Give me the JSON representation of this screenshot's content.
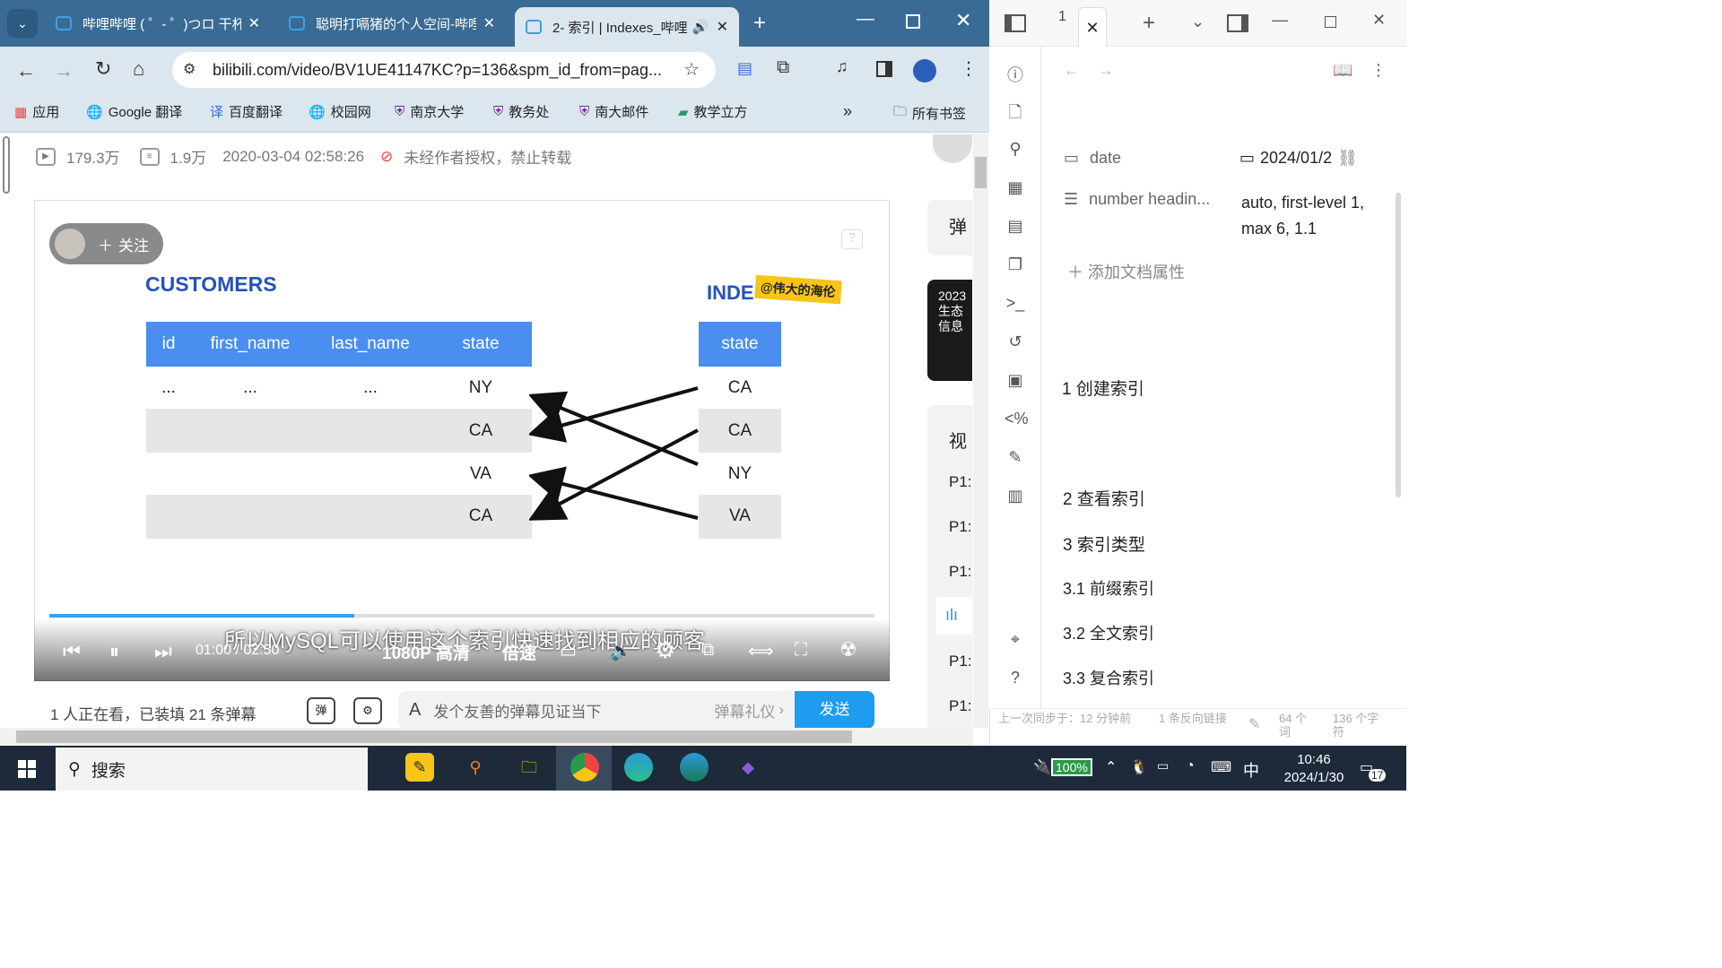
{
  "tabs": [
    {
      "title": "哔哩哔哩 ( ゜- ゜)つロ 干杯",
      "active": false
    },
    {
      "title": "聪明打嗝猪的个人空间-哔哩",
      "active": false
    },
    {
      "title": "2- 索引 | Indexes_哔哩",
      "active": true
    }
  ],
  "url": "bilibili.com/video/BV1UE41147KC?p=136&spm_id_from=pag...",
  "bookmarks": [
    "应用",
    "Google 翻译",
    "百度翻译",
    "校园网",
    "南京大学",
    "教务处",
    "南大邮件",
    "教学立方"
  ],
  "bookmarks_all": "所有书签",
  "video_meta": {
    "views": "179.3万",
    "danmaku": "1.9万",
    "date": "2020-03-04 02:58:26",
    "notice": "未经作者授权，禁止转载"
  },
  "follow": "关注",
  "customers_title": "CUSTOMERS",
  "index_title": "INDE",
  "watermark": "@伟大的海伦",
  "customers_headers": [
    "id",
    "first_name",
    "last_name",
    "state"
  ],
  "customers_rows": [
    [
      "...",
      "...",
      "...",
      "NY"
    ],
    [
      "",
      "",
      "",
      "CA"
    ],
    [
      "",
      "",
      "",
      "VA"
    ],
    [
      "",
      "",
      "",
      "CA"
    ]
  ],
  "index_header": "state",
  "index_rows": [
    "CA",
    "CA",
    "NY",
    "VA"
  ],
  "subtitle": "所以MySQL可以使用这个索引快速找到相应的顾客",
  "player": {
    "time": "01:00",
    "duration": "02:50",
    "quality": "1080P 高清",
    "speed": "倍速",
    "progress": 0.37
  },
  "viewers": "1 人正在看，已装填 21 条弹幕",
  "danmaku_placeholder": "发个友善的弹幕见证当下",
  "danmaku_etiquette": "弹幕礼仪",
  "send": "发送",
  "side_panel": {
    "danmaku_label": "弹",
    "card_text": [
      "2023",
      "生态",
      "信息"
    ],
    "video_label": "视",
    "list": [
      "P1:",
      "P1:",
      "P1:",
      "P1:",
      "P1:"
    ]
  },
  "notes": {
    "date_label": "date",
    "date_value": "2024/01/2",
    "numhead_label": "number headin...",
    "numhead_value": "auto, first-level 1, max 6, 1.1",
    "add_prop": "添加文档属性",
    "headings": [
      "1 创建索引",
      "2 查看索引",
      "3 索引类型",
      "3.1 前缀索引",
      "3.2 全文索引",
      "3.3 复合索引"
    ],
    "status": {
      "sync": "上一次同步于：12 分钟前",
      "backlinks": "1 条反向链接",
      "words": "64 个词",
      "chars": "136 个字符"
    },
    "tab_num": "1"
  },
  "taskbar": {
    "search": "搜索",
    "battery": "100%",
    "ime": "中",
    "time": "10:46",
    "date": "2024/1/30",
    "notif": "17"
  }
}
